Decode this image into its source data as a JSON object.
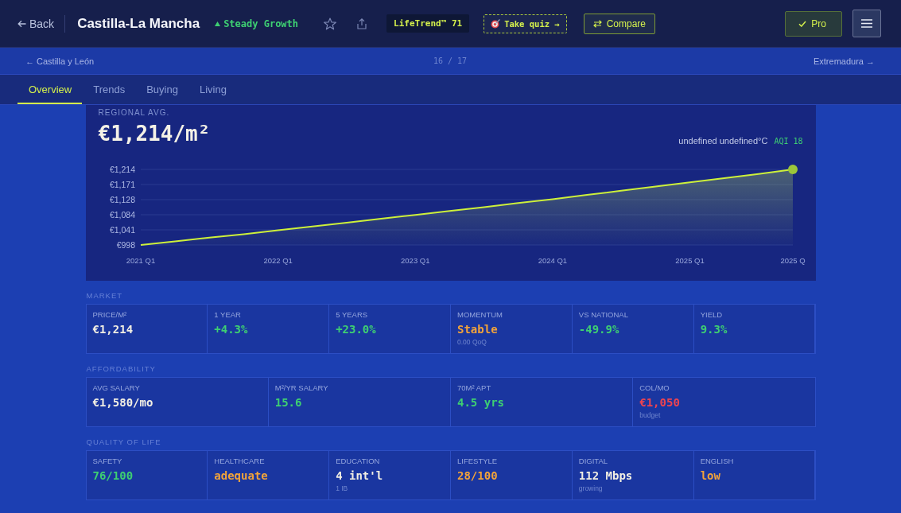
{
  "header": {
    "back_label": "Back",
    "title": "Castilla-La Mancha",
    "trend": "Steady Growth",
    "score_badge": "LifeTrend™ 71",
    "quiz_button": "Take quiz →",
    "compare_button": "Compare",
    "pro_button": "Pro"
  },
  "region_nav": {
    "previous": "← Castilla y León",
    "position": "16 / 17",
    "next": "Extremadura →"
  },
  "tabs": [
    {
      "label": "Overview",
      "selected": true
    },
    {
      "label": "Trends",
      "selected": false
    },
    {
      "label": "Buying",
      "selected": false
    },
    {
      "label": "Living",
      "selected": false
    }
  ],
  "price_card": {
    "label": "REGIONAL AVG.",
    "price": "€1,214/m²",
    "weather": "undefined undefined°C",
    "aqi": "AQI 18",
    "chart_data": {
      "type": "area",
      "grid": true,
      "categories": [
        "2021 Q1",
        null,
        null,
        null,
        "2022 Q1",
        null,
        null,
        null,
        "2023 Q1",
        null,
        null,
        null,
        "2024 Q1",
        null,
        null,
        null,
        "2025 Q1",
        null,
        null,
        "2025 Q"
      ],
      "values": [
        998,
        1008,
        1019,
        1029,
        1040,
        1051,
        1062,
        1073,
        1084,
        1095,
        1106,
        1118,
        1129,
        1141,
        1153,
        1165,
        1177,
        1189,
        1201,
        1214
      ],
      "ylim": [
        998,
        1214
      ],
      "yticks": [
        {
          "value": 998,
          "label": "€998"
        },
        {
          "value": 1041.2,
          "label": "€1,041"
        },
        {
          "value": 1084.4,
          "label": "€1,084"
        },
        {
          "value": 1127.6,
          "label": "€1,128"
        },
        {
          "value": 1170.8,
          "label": "€1,171"
        },
        {
          "value": 1214,
          "label": "€1,214"
        }
      ]
    }
  },
  "sections": [
    {
      "title": "MARKET",
      "metrics": [
        {
          "label": "PRICE/M²",
          "value": "€1,214",
          "color": "#f2efe3"
        },
        {
          "label": "1 YEAR",
          "value": "+4.3%",
          "color": "#3ecf72"
        },
        {
          "label": "5 YEARS",
          "value": "+23.0%",
          "color": "#3ecf72"
        },
        {
          "label": "MOMENTUM",
          "value": "Stable",
          "color": "#f2a33a",
          "note": "0.00 QoQ"
        },
        {
          "label": "VS NATIONAL",
          "value": "-49.9%",
          "color": "#3ecf72"
        },
        {
          "label": "YIELD",
          "value": "9.3%",
          "color": "#3ecf72"
        }
      ]
    },
    {
      "title": "AFFORDABILITY",
      "metrics": [
        {
          "label": "AVG SALARY",
          "value": "€1,580/mo",
          "color": "#f2efe3"
        },
        {
          "label": "M²/YR SALARY",
          "value": "15.6",
          "color": "#3ecf72"
        },
        {
          "label": "70M² APT",
          "value": "4.5 yrs",
          "color": "#3ecf72"
        },
        {
          "label": "COL/MO",
          "value": "€1,050",
          "color": "#ee4450",
          "note": "budget"
        }
      ]
    },
    {
      "title": "QUALITY OF LIFE",
      "metrics": [
        {
          "label": "SAFETY",
          "value": "76/100",
          "color": "#3ecf72"
        },
        {
          "label": "HEALTHCARE",
          "value": "adequate",
          "color": "#f2a33a"
        },
        {
          "label": "EDUCATION",
          "value": "4 int'l",
          "color": "#f2efe3",
          "note": "1 IB"
        },
        {
          "label": "LIFESTYLE",
          "value": "28/100",
          "color": "#f2a33a"
        },
        {
          "label": "DIGITAL",
          "value": "112 Mbps",
          "color": "#f2efe3",
          "note": "growing"
        },
        {
          "label": "ENGLISH",
          "value": "low",
          "color": "#f2a33a"
        }
      ]
    }
  ]
}
